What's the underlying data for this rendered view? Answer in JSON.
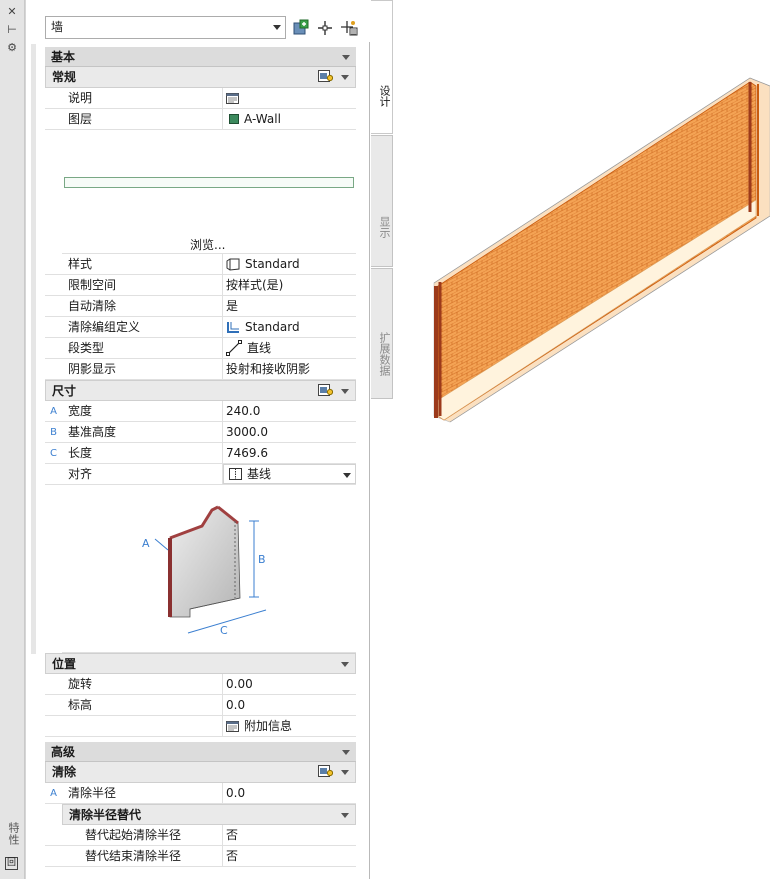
{
  "left_strip": {
    "close_glyph": "✕",
    "pin_glyph": "⊢",
    "settings_glyph": "⚙",
    "title": "特性",
    "bottom_glyph": "回"
  },
  "header": {
    "object_type": "墙"
  },
  "tabs": [
    {
      "label": "设计",
      "active": true
    },
    {
      "label": "显示",
      "active": false
    },
    {
      "label": "扩展数据",
      "active": false
    }
  ],
  "categories": {
    "basic": "基本",
    "general": "常规",
    "dimensions": "尺寸",
    "location": "位置",
    "advanced": "高级",
    "cleanup": "清除",
    "cleanup_override": "清除半径替代"
  },
  "general_rows": [
    {
      "label": "说明",
      "value": ""
    },
    {
      "label": "图层",
      "value": "A-Wall",
      "swatch": "#3c8a5e"
    }
  ],
  "browse_label": "浏览...",
  "general_rows2": [
    {
      "label": "样式",
      "value": "Standard"
    },
    {
      "label": "限制空间",
      "value": "按样式(是)"
    },
    {
      "label": "自动清除",
      "value": "是"
    },
    {
      "label": "清除编组定义",
      "value": "Standard"
    },
    {
      "label": "段类型",
      "value": "直线"
    },
    {
      "label": "阴影显示",
      "value": "投射和接收阴影"
    }
  ],
  "dimension_rows": [
    {
      "key": "A",
      "label": "宽度",
      "value": "240.0"
    },
    {
      "key": "B",
      "label": "基准高度",
      "value": "3000.0"
    },
    {
      "key": "C",
      "label": "长度",
      "value": "7469.6"
    }
  ],
  "justify": {
    "label": "对齐",
    "value": "基线"
  },
  "diagram_labels": {
    "a": "A",
    "b": "B",
    "c": "C"
  },
  "location_rows": [
    {
      "label": "旋转",
      "value": "0.00"
    },
    {
      "label": "标高",
      "value": "0.0"
    }
  ],
  "extra_info_label": "附加信息",
  "cleanup_rows": [
    {
      "key": "A",
      "label": "清除半径",
      "value": "0.0"
    }
  ],
  "override_rows": [
    {
      "label": "替代起始清除半径",
      "value": "否"
    },
    {
      "label": "替代结束清除半径",
      "value": "否"
    }
  ],
  "colors": {
    "wall_fill": "#f3a14f",
    "wall_lines": "#c85c10",
    "wall_end": "#9c3a1b"
  }
}
